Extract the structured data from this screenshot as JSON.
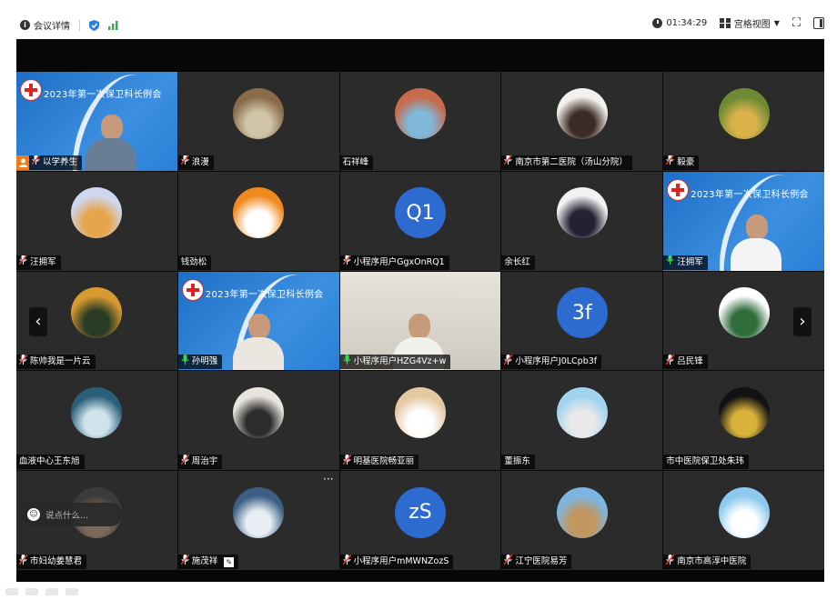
{
  "topbar": {
    "meeting_info": "会议详情",
    "timer": "01:34:29",
    "view_mode": "宫格视图"
  },
  "banner_title": "2023年第一次保卫科长例会",
  "participants": [
    {
      "name": "以学养生",
      "type": "banner",
      "host": true
    },
    {
      "name": "浪漫",
      "type": "avatar",
      "colors": [
        "#8a6b4a",
        "#cfc4a8"
      ]
    },
    {
      "name": "石祥峰",
      "type": "avatar",
      "colors": [
        "#c86a4c",
        "#7fb8d9"
      ]
    },
    {
      "name": "南京市第二医院（汤山分院）",
      "type": "avatar",
      "colors": [
        "#f3f0ed",
        "#3d2b25"
      ]
    },
    {
      "name": "毅豪",
      "type": "avatar",
      "colors": [
        "#6e8a34",
        "#d9b24a"
      ]
    },
    {
      "name": "汪拥军",
      "type": "avatar",
      "colors": [
        "#cfd6ef",
        "#e6a54a"
      ]
    },
    {
      "name": "钱劲松",
      "type": "avatar",
      "colors": [
        "#f08a1e",
        "#ffffff"
      ]
    },
    {
      "name": "小程序用户GgxOnRQ1",
      "type": "letters",
      "letters": "Q1"
    },
    {
      "name": "余长红",
      "type": "avatar",
      "colors": [
        "#f1f1f1",
        "#223"
      ]
    },
    {
      "name": "汪拥军",
      "type": "banner"
    },
    {
      "name": "陈帅我是一片云",
      "type": "avatar",
      "colors": [
        "#d69a32",
        "#2a3b24"
      ]
    },
    {
      "name": "孙明强",
      "type": "banner"
    },
    {
      "name": "小程序用户HZG4Vz+w",
      "type": "office",
      "active": true
    },
    {
      "name": "小程序用户J0LCpb3f",
      "type": "letters",
      "letters": "3f"
    },
    {
      "name": "吕民锋",
      "type": "avatar",
      "colors": [
        "#ffffff",
        "#2f6d3a"
      ]
    },
    {
      "name": "血液中心王东旭",
      "type": "avatar",
      "colors": [
        "#2a5f7a",
        "#cfe3ea"
      ],
      "no_mic": true
    },
    {
      "name": "周治宇",
      "type": "avatar",
      "colors": [
        "#e8e4de",
        "#2c2c2c"
      ]
    },
    {
      "name": "明基医院畅亚丽",
      "type": "avatar",
      "colors": [
        "#e4c8a2",
        "#ffffff"
      ]
    },
    {
      "name": "董振东",
      "type": "avatar",
      "colors": [
        "#9fd3ee",
        "#e9e9e9"
      ],
      "no_mic": true
    },
    {
      "name": "市中医院保卫处朱玮",
      "type": "avatar",
      "colors": [
        "#121212",
        "#d8b23b"
      ],
      "no_mic": true
    },
    {
      "name": "市妇幼姜慧君",
      "type": "avatar",
      "colors": [
        "#3b3b3b",
        "#7d6a5a"
      ]
    },
    {
      "name": "施茂祥",
      "type": "avatar",
      "colors": [
        "#3d5f86",
        "#e8eef3"
      ],
      "pencil": true,
      "more": true
    },
    {
      "name": "小程序用户mMWNZozS",
      "type": "letters",
      "letters": "zS"
    },
    {
      "name": "江宁医院易芳",
      "type": "avatar",
      "colors": [
        "#7bb6e3",
        "#c2965f"
      ]
    },
    {
      "name": "南京市高淳中医院",
      "type": "avatar",
      "colors": [
        "#8cc9ef",
        "#ffffff"
      ]
    }
  ],
  "chat": {
    "placeholder": "说点什么..."
  }
}
